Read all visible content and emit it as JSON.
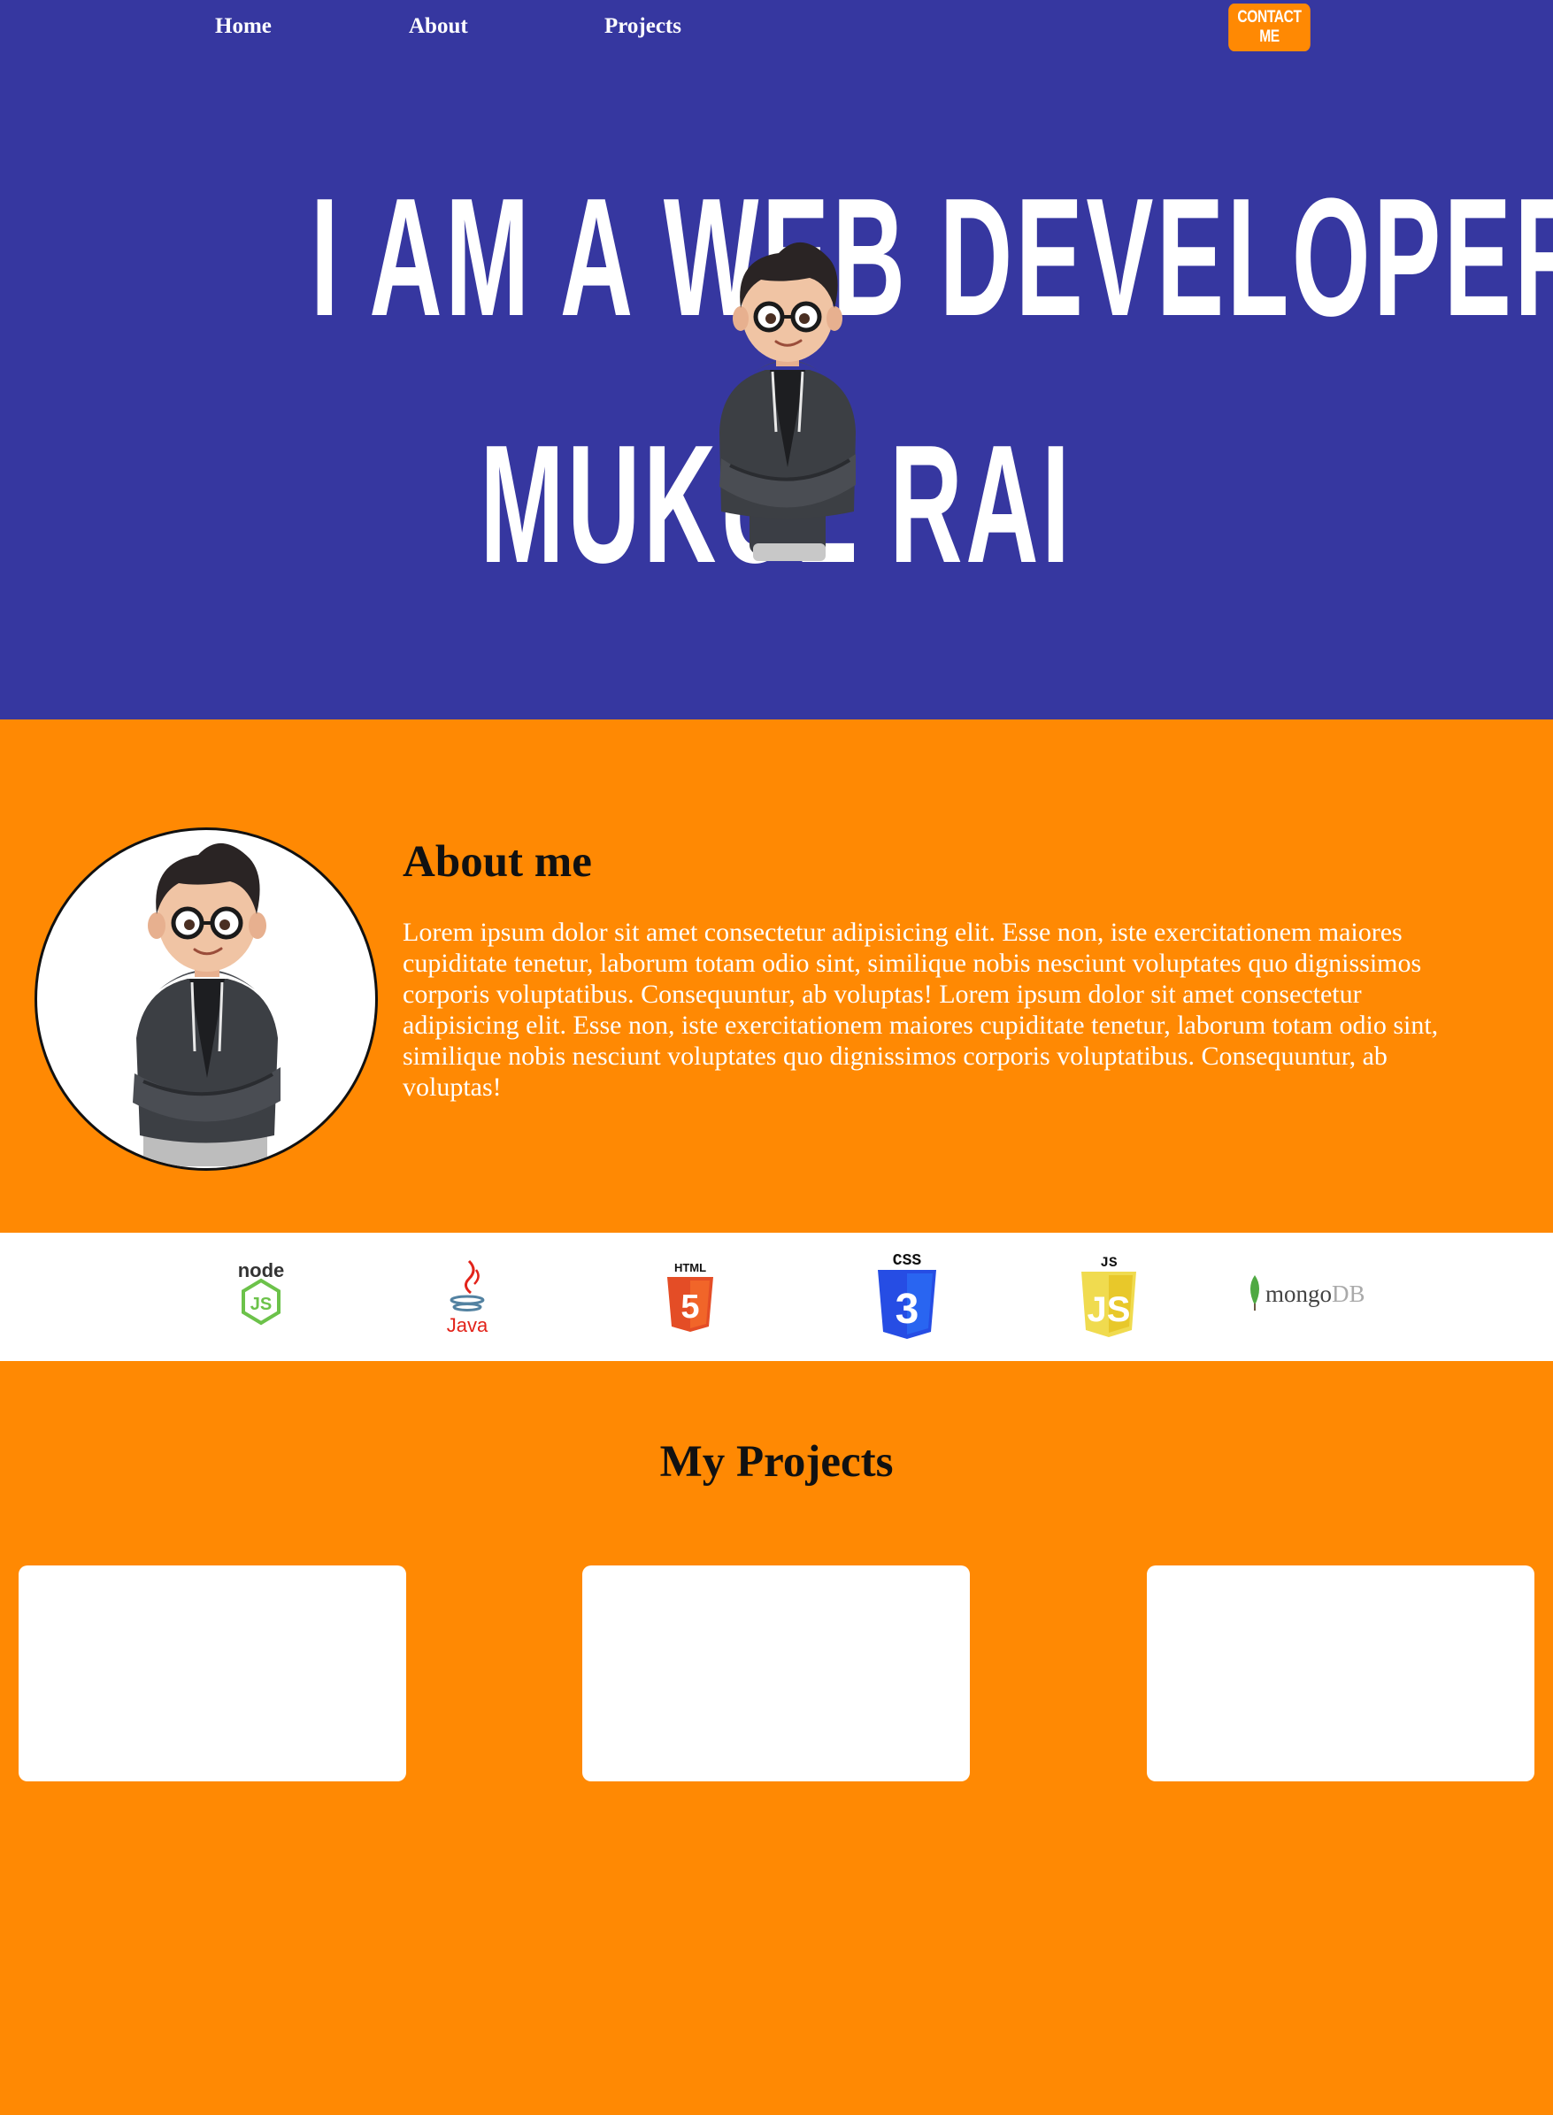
{
  "nav": {
    "links": [
      "Home",
      "About",
      "Projects"
    ],
    "contact_label": "CONTACT ME"
  },
  "hero": {
    "line1": "I AM A WEB DEVELOPER",
    "line2": "MUKUL RAI",
    "avatar_icon": "cartoon-developer-avatar"
  },
  "about": {
    "title": "About me",
    "text": "Lorem ipsum dolor sit amet consectetur adipisicing elit. Esse non, iste exercitationem maiores cupiditate tenetur, laborum totam odio sint, similique nobis nesciunt voluptates quo dignissimos corporis voluptatibus. Consequuntur, ab voluptas! Lorem ipsum dolor sit amet consectetur adipisicing elit. Esse non, iste exercitationem maiores cupiditate tenetur, laborum totam odio sint, similique nobis nesciunt voluptates quo dignissimos corporis voluptatibus. Consequuntur, ab voluptas!"
  },
  "skills": {
    "node": "node",
    "node_js": "JS",
    "java": "Java",
    "html": "HTML",
    "html_num": "5",
    "css": "CSS",
    "css_num": "3",
    "js": "JS",
    "js_badge": "JS",
    "mongo_a": "mongo",
    "mongo_b": "DB"
  },
  "projects": {
    "title": "My Projects",
    "cards": [
      "",
      "",
      ""
    ]
  },
  "colors": {
    "hero_bg": "#3637a0",
    "accent": "#ff8903",
    "white": "#ffffff",
    "dark": "#111111"
  }
}
